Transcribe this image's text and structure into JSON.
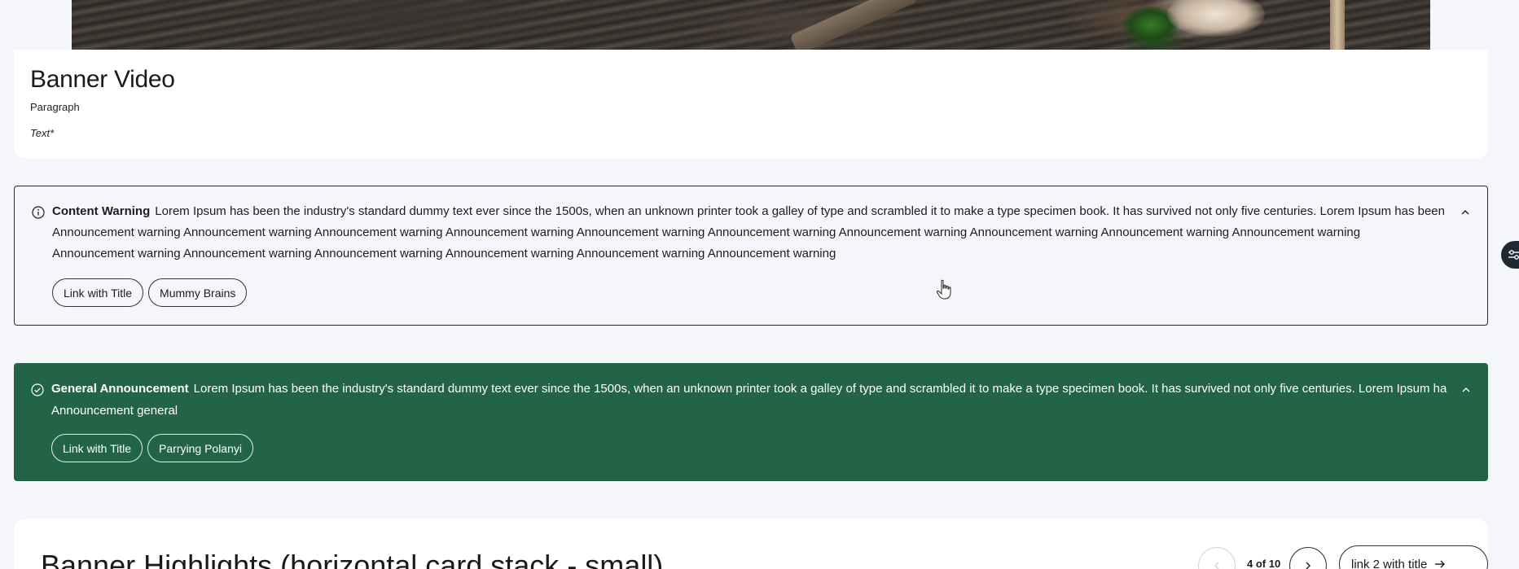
{
  "hero": {
    "alt": "banner image"
  },
  "banner_video": {
    "title": "Banner Video",
    "paragraph_label": "Paragraph",
    "text_label": "Text*"
  },
  "content_warning": {
    "label": "Content Warning",
    "summary": "Lorem Ipsum has been the industry's standard dummy text ever since the 1500s, when an unknown printer took a galley of type and scrambled it to make a type specimen book. It has survived not only five centuries. Lorem Ipsum has been ...",
    "line2": "Announcement warning Announcement warning Announcement warning Announcement warning Announcement warning Announcement warning Announcement warning Announcement warning Announcement warning Announcement warning",
    "line3": "Announcement warning Announcement warning Announcement warning Announcement warning Announcement warning Announcement warning",
    "links": [
      "Link with Title",
      "Mummy Brains"
    ],
    "icon": "info-icon",
    "toggle_icon": "chevron-up-icon"
  },
  "general_announcement": {
    "label": "General Announcement",
    "summary": "Lorem Ipsum has been the industry's standard dummy text ever since the 1500s, when an unknown printer took a galley of type and scrambled it to make a type specimen book. It has survived not only five centuries. Lorem Ipsum ha...",
    "line2": "Announcement general",
    "links": [
      "Link with Title",
      "Parrying Polanyi"
    ],
    "icon": "check-circle-icon",
    "toggle_icon": "chevron-up-icon",
    "background": "#236446"
  },
  "highlights": {
    "heading": "Banner Highlights (horizontal card stack - small)",
    "counter": "4 of 10",
    "link_label": "link 2 with title"
  },
  "side_tab": {
    "icon": "settings-sliders-icon"
  }
}
